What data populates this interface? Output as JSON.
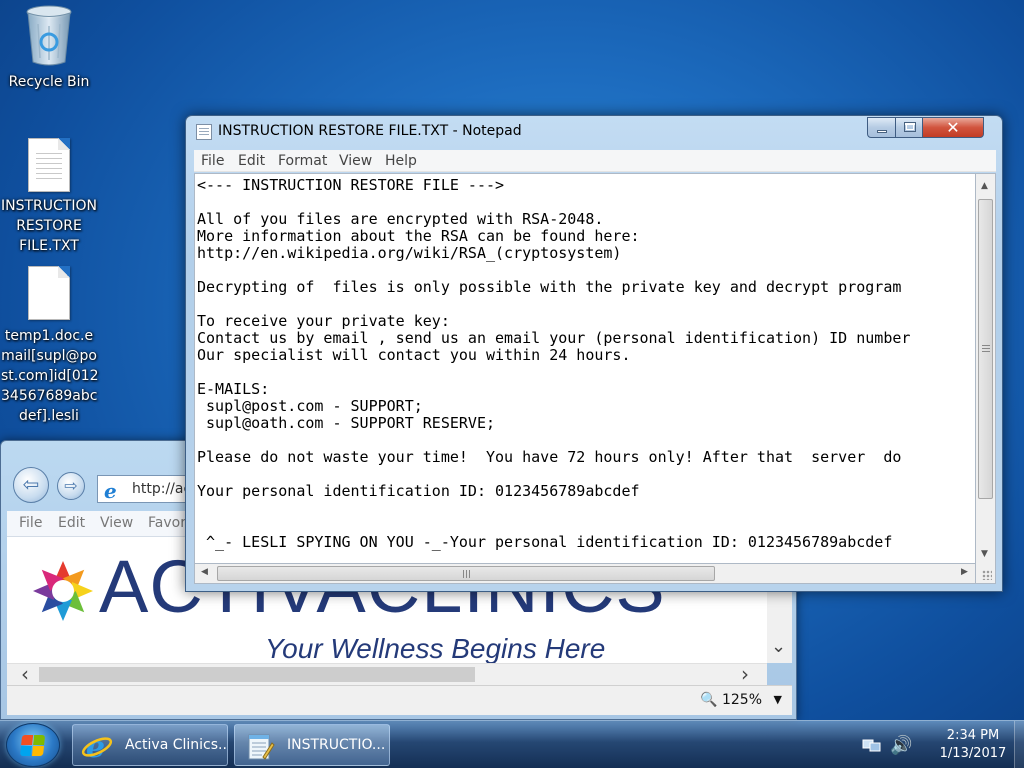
{
  "desktop": {
    "icons": [
      {
        "label": "Recycle Bin"
      },
      {
        "label": "INSTRUCTION RESTORE FILE.TXT"
      },
      {
        "label": "temp1.doc.email[supl@post.com]id[0123456789abcdef].lesli"
      }
    ],
    "icon_label_lines": {
      "txt": [
        "INSTRUCTION",
        "RESTORE",
        "FILE.TXT"
      ],
      "doc": [
        "temp1.doc.e",
        "mail[supl@po",
        "st.com]id[012",
        "34567689abc",
        "def].lesli"
      ]
    }
  },
  "ie_window": {
    "address_text": "http://ac",
    "menu": [
      "File",
      "Edit",
      "View",
      "Favor"
    ],
    "brand_name": "ACTIVACLINICS",
    "tagline": "Your Wellness Begins Here",
    "zoom": "125%"
  },
  "notepad": {
    "title": "INSTRUCTION RESTORE FILE.TXT - Notepad",
    "menu": [
      "File",
      "Edit",
      "Format",
      "View",
      "Help"
    ],
    "lines": [
      "<--- INSTRUCTION RESTORE FILE --->",
      "",
      "All of you files are encrypted with RSA-2048.",
      "More information about the RSA can be found here:",
      "http://en.wikipedia.org/wiki/RSA_(cryptosystem)",
      "",
      "Decrypting of  files is only possible with the private key and decrypt program",
      "",
      "To receive your private key:",
      "Contact us by email , send us an email your (personal identification) ID number",
      "Our specialist will contact you within 24 hours.",
      "",
      "E-MAILS:",
      " supl@post.com - SUPPORT;",
      " supl@oath.com - SUPPORT RESERVE;",
      "",
      "Please do not waste your time!  You have 72 hours only! After that  server  do",
      "",
      "Your personal identification ID: 0123456789abcdef",
      "",
      "",
      " ^_- LESLI SPYING ON YOU -_-Your personal identification ID: 0123456789abcdef"
    ]
  },
  "taskbar": {
    "buttons": [
      {
        "label": "Activa Clinics..."
      },
      {
        "label": "INSTRUCTIO..."
      }
    ],
    "clock": {
      "time": "2:34 PM",
      "date": "1/13/2017"
    }
  },
  "colors": {
    "desktop_blue": "#1d6cbf",
    "brand_navy": "#243a79",
    "close_red": "#c23c25"
  }
}
